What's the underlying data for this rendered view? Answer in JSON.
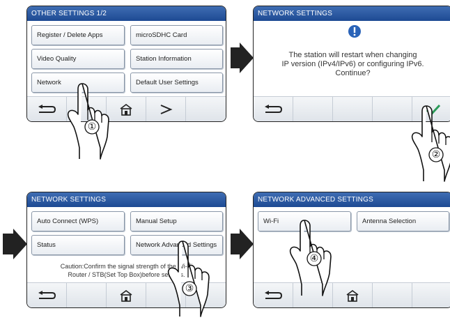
{
  "screen1": {
    "title": "OTHER SETTINGS  1/2",
    "buttons": [
      "Register / Delete Apps",
      "microSDHC Card",
      "Video Quality",
      "Station Information",
      "Network",
      "Default User Settings"
    ],
    "step": "①"
  },
  "screen2": {
    "title": "NETWORK SETTINGS",
    "message": [
      "The station will restart when changing",
      "IP version (IPv4/IPv6) or configuring IPv6.",
      "Continue?"
    ],
    "step": "②"
  },
  "screen3": {
    "title": "NETWORK SETTINGS",
    "buttons": [
      "Auto Connect (WPS)",
      "Manual Setup",
      "Status",
      "Network Advanced Settings"
    ],
    "caution": [
      "Caution:Confirm the signal strength of the Wi-Fi",
      "Router / STB(Set Top Box)before settings."
    ],
    "step": "③"
  },
  "screen4": {
    "title": "NETWORK ADVANCED SETTINGS",
    "buttons": [
      "Wi-Fi",
      "Antenna Selection"
    ],
    "step": "④"
  },
  "icons": {
    "back": "back-arrow-icon",
    "home": "home-icon",
    "next": "forward-chevron-icon",
    "confirm": "checkmark-icon",
    "alert": "exclamation-icon",
    "pointer": "pointing-hand-icon",
    "flow": "flow-arrow-icon"
  },
  "colors": {
    "titlebar": "#1d4a93",
    "check": "#2a9a58",
    "alert": "#2a63b8"
  }
}
